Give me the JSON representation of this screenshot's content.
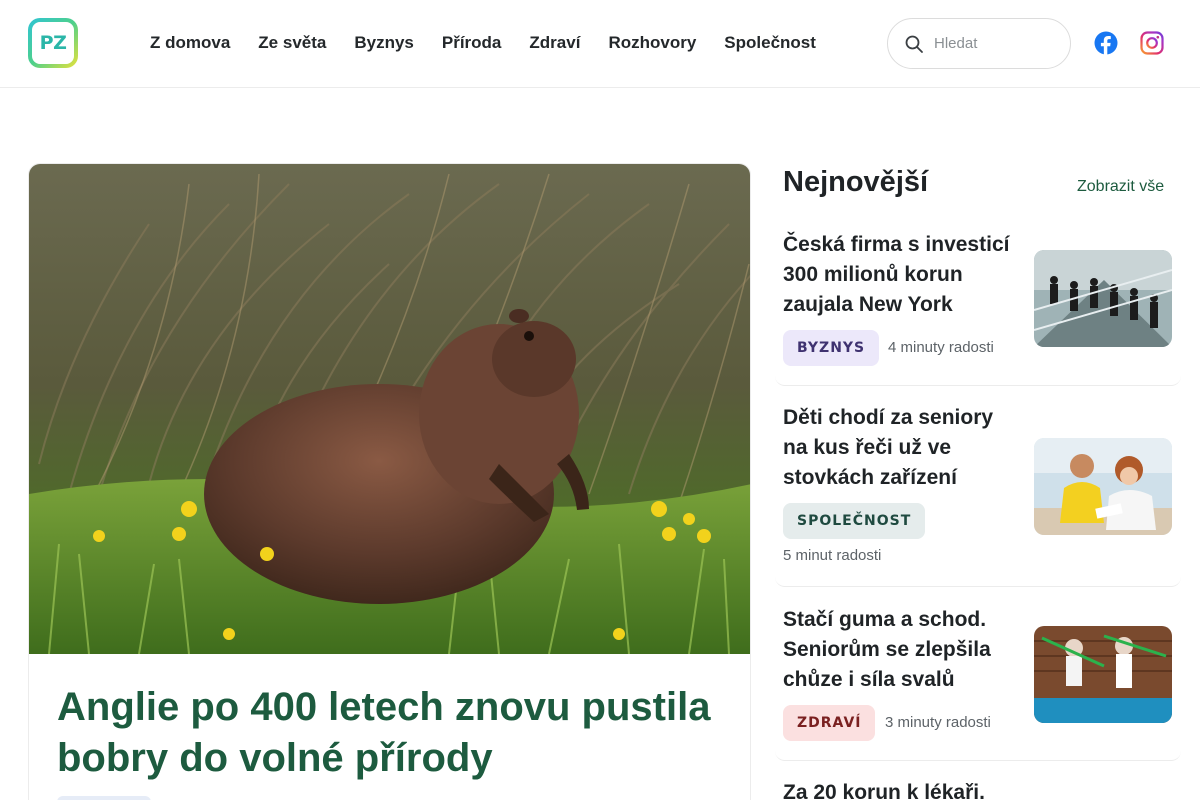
{
  "header": {
    "logo_text": "PZ",
    "nav": [
      "Z domova",
      "Ze světa",
      "Byznys",
      "Příroda",
      "Zdraví",
      "Rozhovory",
      "Společnost"
    ],
    "search_placeholder": "Hledat",
    "social": [
      "facebook-icon",
      "instagram-icon"
    ]
  },
  "hero": {
    "title": "Anglie po 400 letech znovu pustila bobry do volné přírody",
    "image": "beaver-in-grass"
  },
  "sidebar": {
    "heading": "Nejnovější",
    "show_all": "Zobrazit vše",
    "articles": [
      {
        "title": "Česká firma s investicí 300 milionů korun zaujala New York",
        "category": "BYZNYS",
        "read_time": "4 minuty radosti"
      },
      {
        "title": "Děti chodí za seniory na kus řeči už ve stovkách zařízení",
        "category": "SPOLEČNOST",
        "read_time": "5 minut radosti"
      },
      {
        "title": "Stačí guma a schod. Seniorům se zlepšila chůze i síla svalů",
        "category": "ZDRAVÍ",
        "read_time": "3 minuty radosti"
      },
      {
        "title": "Za 20 korun k lékaři."
      }
    ]
  },
  "colors": {
    "brand_green": "#1d5b3f",
    "badge_byznys": "#ece8fa",
    "badge_spolecnost": "#e5ecec",
    "badge_zdravi": "#fbe0e0",
    "facebook_blue": "#1877f2"
  }
}
